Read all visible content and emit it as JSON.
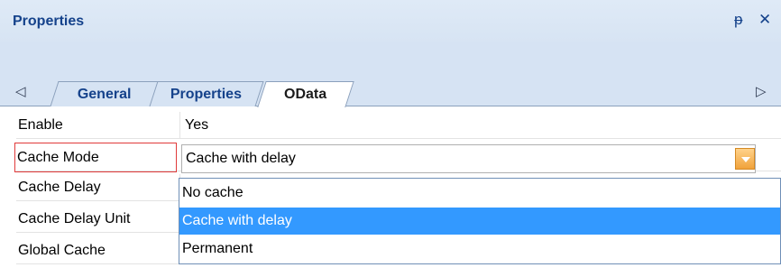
{
  "panel": {
    "title": "Properties",
    "pin_glyph": "ᵽ",
    "close_glyph": "✕"
  },
  "tabs": {
    "nav_left_glyph": "◁",
    "nav_right_glyph": "▷",
    "items": [
      {
        "label": "General"
      },
      {
        "label": "Properties"
      },
      {
        "label": "OData"
      }
    ],
    "active": "OData"
  },
  "grid": {
    "rows": [
      {
        "name": "Enable",
        "value": "Yes"
      },
      {
        "name": "Cache Mode",
        "value": "Cache with delay"
      },
      {
        "name": "Cache Delay",
        "value": ""
      },
      {
        "name": "Cache Delay Unit",
        "value": ""
      },
      {
        "name": "Global Cache",
        "value": ""
      }
    ]
  },
  "dropdown": {
    "options": [
      "No cache",
      "Cache with delay",
      "Permanent"
    ],
    "selected": "Cache with delay"
  },
  "colors": {
    "accent": "#3399ff",
    "title_text": "#15428b",
    "highlight_border": "#e03a3a",
    "dropdown_button": "#f0a23b"
  }
}
